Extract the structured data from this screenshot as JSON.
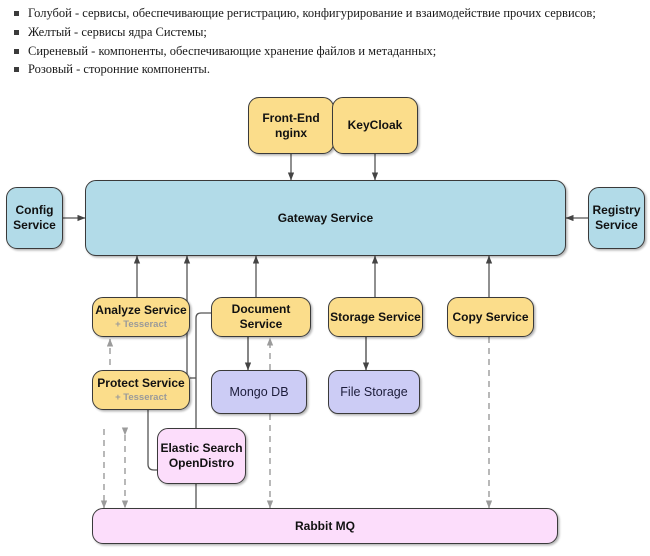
{
  "legend": {
    "items": [
      {
        "marker": "square-bullet",
        "text": "Голубой - сервисы, обеспечивающие регистрацию, конфигурирование и взаимодействие прочих сервисов;"
      },
      {
        "marker": "square-bullet",
        "text": "Желтый - сервисы ядра Системы;"
      },
      {
        "marker": "square-bullet",
        "text": "Сиреневый - компоненты, обеспечивающие хранение файлов и метаданных;"
      },
      {
        "marker": "square-bullet",
        "text": "Розовый - сторонние компоненты."
      }
    ]
  },
  "diagram": {
    "type": "architecture-block-diagram",
    "colors": {
      "yellow": "#fbdd8b",
      "blue": "#b2dbe8",
      "purple": "#ccccf5",
      "pink": "#fcddfb",
      "stroke": "#3a3a3a",
      "connector_solid": "#555555",
      "connector_dashed": "#9b9b9b",
      "subtitle": "#9a9a9a"
    },
    "nodes": {
      "frontend": {
        "line1": "Front-End",
        "line2": "nginx",
        "color": "yellow"
      },
      "keycloak": {
        "line1": "KeyCloak",
        "color": "yellow"
      },
      "config": {
        "line1": "Config",
        "line2": "Service",
        "color": "blue"
      },
      "gateway": {
        "line1": "Gateway Service",
        "color": "blue"
      },
      "registry": {
        "line1": "Registry",
        "line2": "Service",
        "color": "blue"
      },
      "analyze": {
        "line1": "Analyze Service",
        "sub": "+ Tesseract",
        "color": "yellow"
      },
      "document": {
        "line1": "Document Service",
        "color": "yellow"
      },
      "storage": {
        "line1": "Storage Service",
        "color": "yellow"
      },
      "copy": {
        "line1": "Copy Service",
        "color": "yellow"
      },
      "protect": {
        "line1": "Protect Service",
        "sub": "+ Tesseract",
        "color": "yellow"
      },
      "mongo": {
        "line1": "Mongo DB",
        "color": "purple"
      },
      "filestorage": {
        "line1": "File Storage",
        "color": "purple"
      },
      "elastic": {
        "line1": "Elastic Search",
        "line2": "OpenDistro",
        "color": "pink"
      },
      "rabbit": {
        "line1": "Rabbit MQ",
        "color": "pink"
      }
    }
  }
}
